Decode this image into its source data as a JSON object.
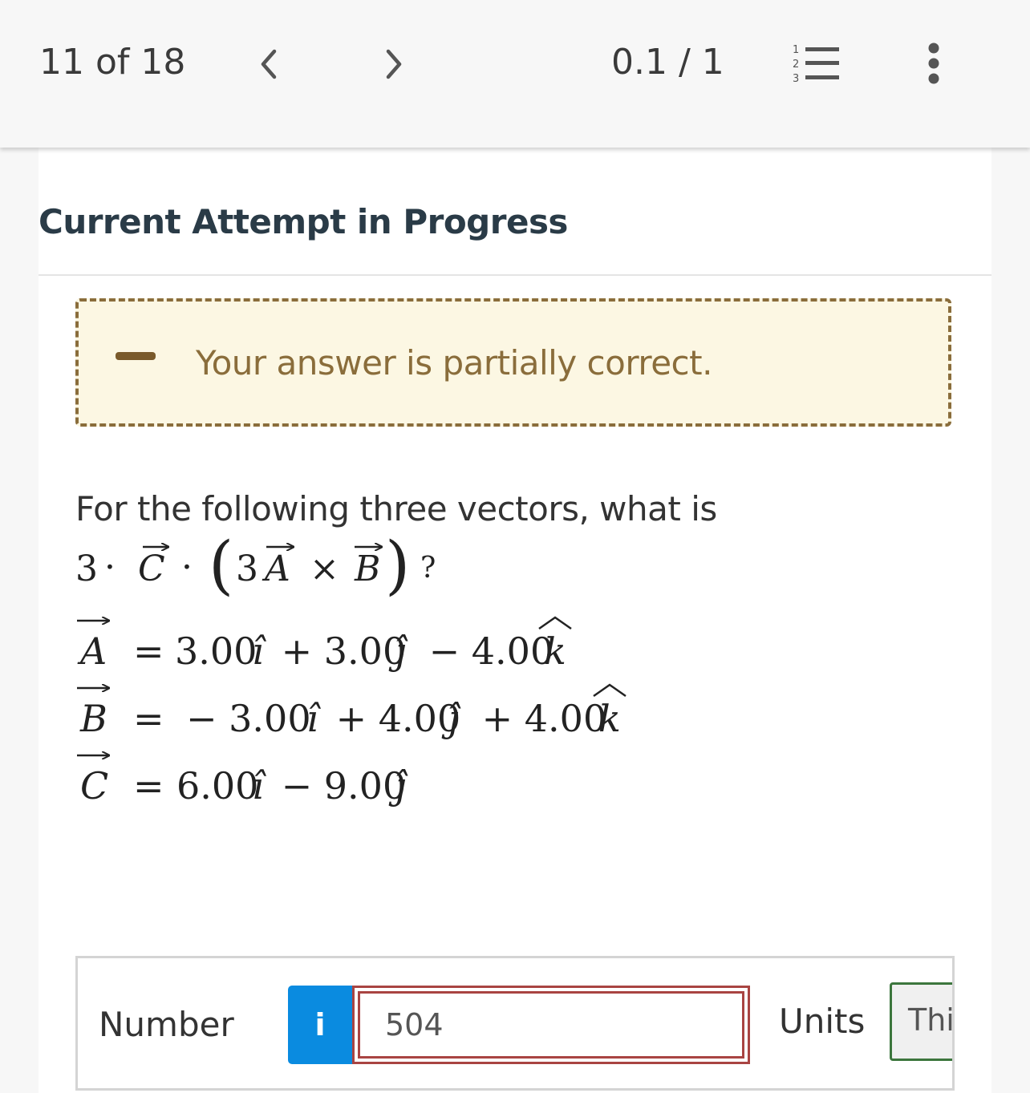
{
  "header": {
    "progress": "11 of 18",
    "score": "0.1 / 1",
    "prev_icon": "chevron-left-icon",
    "next_icon": "chevron-right-icon",
    "list_icon": "numbered-list-icon",
    "list_icon_digits": [
      "1",
      "2",
      "3"
    ],
    "more_icon": "more-vertical-icon"
  },
  "attempt": {
    "title": "Current Attempt in Progress"
  },
  "feedback": {
    "text": "Your answer is partially correct.",
    "status": "partial",
    "border_color": "#8a6d3b",
    "background_color": "#fcf7e3"
  },
  "question": {
    "text": "For the following three vectors, what is",
    "expression": {
      "leading_coefficient": "3",
      "dot": "·",
      "vector_c": "C",
      "open_paren": "(",
      "inner_coefficient": "3",
      "vector_a": "A",
      "cross": "×",
      "vector_b": "B",
      "close_paren": ")",
      "question_mark": "?"
    },
    "equations": [
      {
        "name": "A",
        "equals": "=",
        "rhs": [
          "3.00",
          "î",
          " + 3.00",
          "ĵ",
          " − 4.00",
          "k"
        ]
      },
      {
        "name": "B",
        "equals": "=",
        "rhs": [
          "− 3.00",
          "î",
          " + 4.00",
          "ĵ",
          " + 4.00",
          "k"
        ]
      },
      {
        "name": "C",
        "equals": "=",
        "rhs": [
          "6.00",
          "î",
          " − 9.00",
          "ĵ"
        ]
      }
    ]
  },
  "answer": {
    "number_label": "Number",
    "info_label": "i",
    "number_value": "504",
    "units_label": "Units",
    "units_value": "This answer has no units",
    "info_color": "#0a8be0",
    "error_color": "#a94442",
    "units_border_color": "#3c763d"
  }
}
